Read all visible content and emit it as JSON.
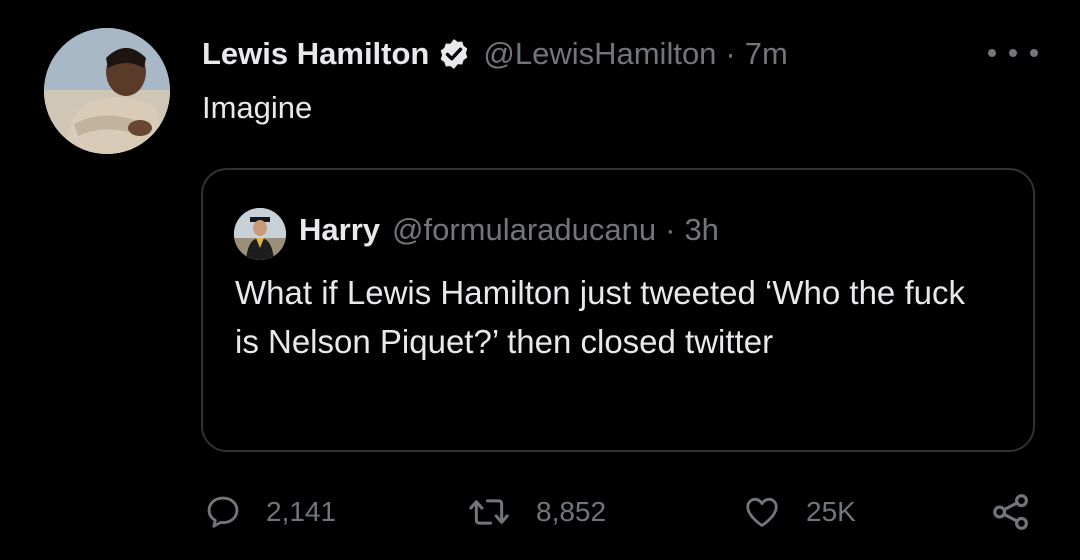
{
  "tweet": {
    "author": {
      "display_name": "Lewis Hamilton",
      "handle": "@LewisHamilton",
      "verified": true
    },
    "separator": "·",
    "time": "7m",
    "text": "Imagine"
  },
  "quoted_tweet": {
    "author": {
      "display_name": "Harry",
      "handle": "@formularaducanu"
    },
    "separator": "·",
    "time": "3h",
    "text": "What if Lewis Hamilton just tweeted ‘Who the fuck is Nelson Piquet?’ then closed twitter"
  },
  "actions": {
    "replies": "2,141",
    "retweets": "8,852",
    "likes": "25K"
  },
  "icons": {
    "verified": "verified-badge-icon",
    "more": "more-dots-icon",
    "reply": "speech-bubble-icon",
    "retweet": "retweet-arrows-icon",
    "like": "heart-icon",
    "share": "share-nodes-icon"
  },
  "colors": {
    "background": "#000000",
    "primary_text": "#e7e9ea",
    "secondary_text": "#71767b",
    "border": "#2f3336"
  }
}
